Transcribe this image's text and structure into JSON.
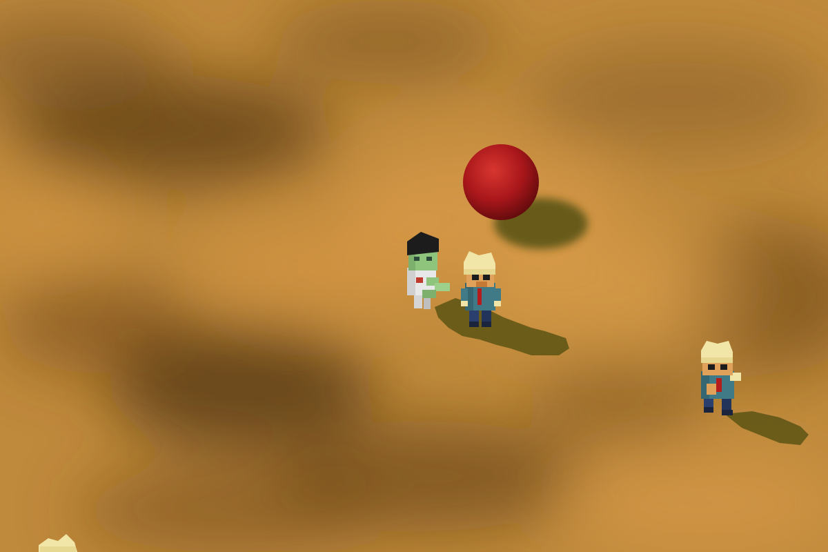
{
  "scene": {
    "ground_color": "#c08a3c",
    "dark_patch_color": "#5a3a14",
    "light_patch_color": "#e1a14f"
  },
  "objects": {
    "ball_color": "#b5171d",
    "shadow_color": "#5c5414"
  },
  "characters": {
    "zombie": {
      "hair_color": "#1c1c1c",
      "skin_color": "#8fc47d",
      "shirt_color": "#e8e8e8"
    },
    "farmer": {
      "hair_color": "#f1e6a8",
      "shirt_color": "#3f7a86",
      "pants_color": "#2a3f6e",
      "tie_color": "#b71c1c"
    }
  }
}
